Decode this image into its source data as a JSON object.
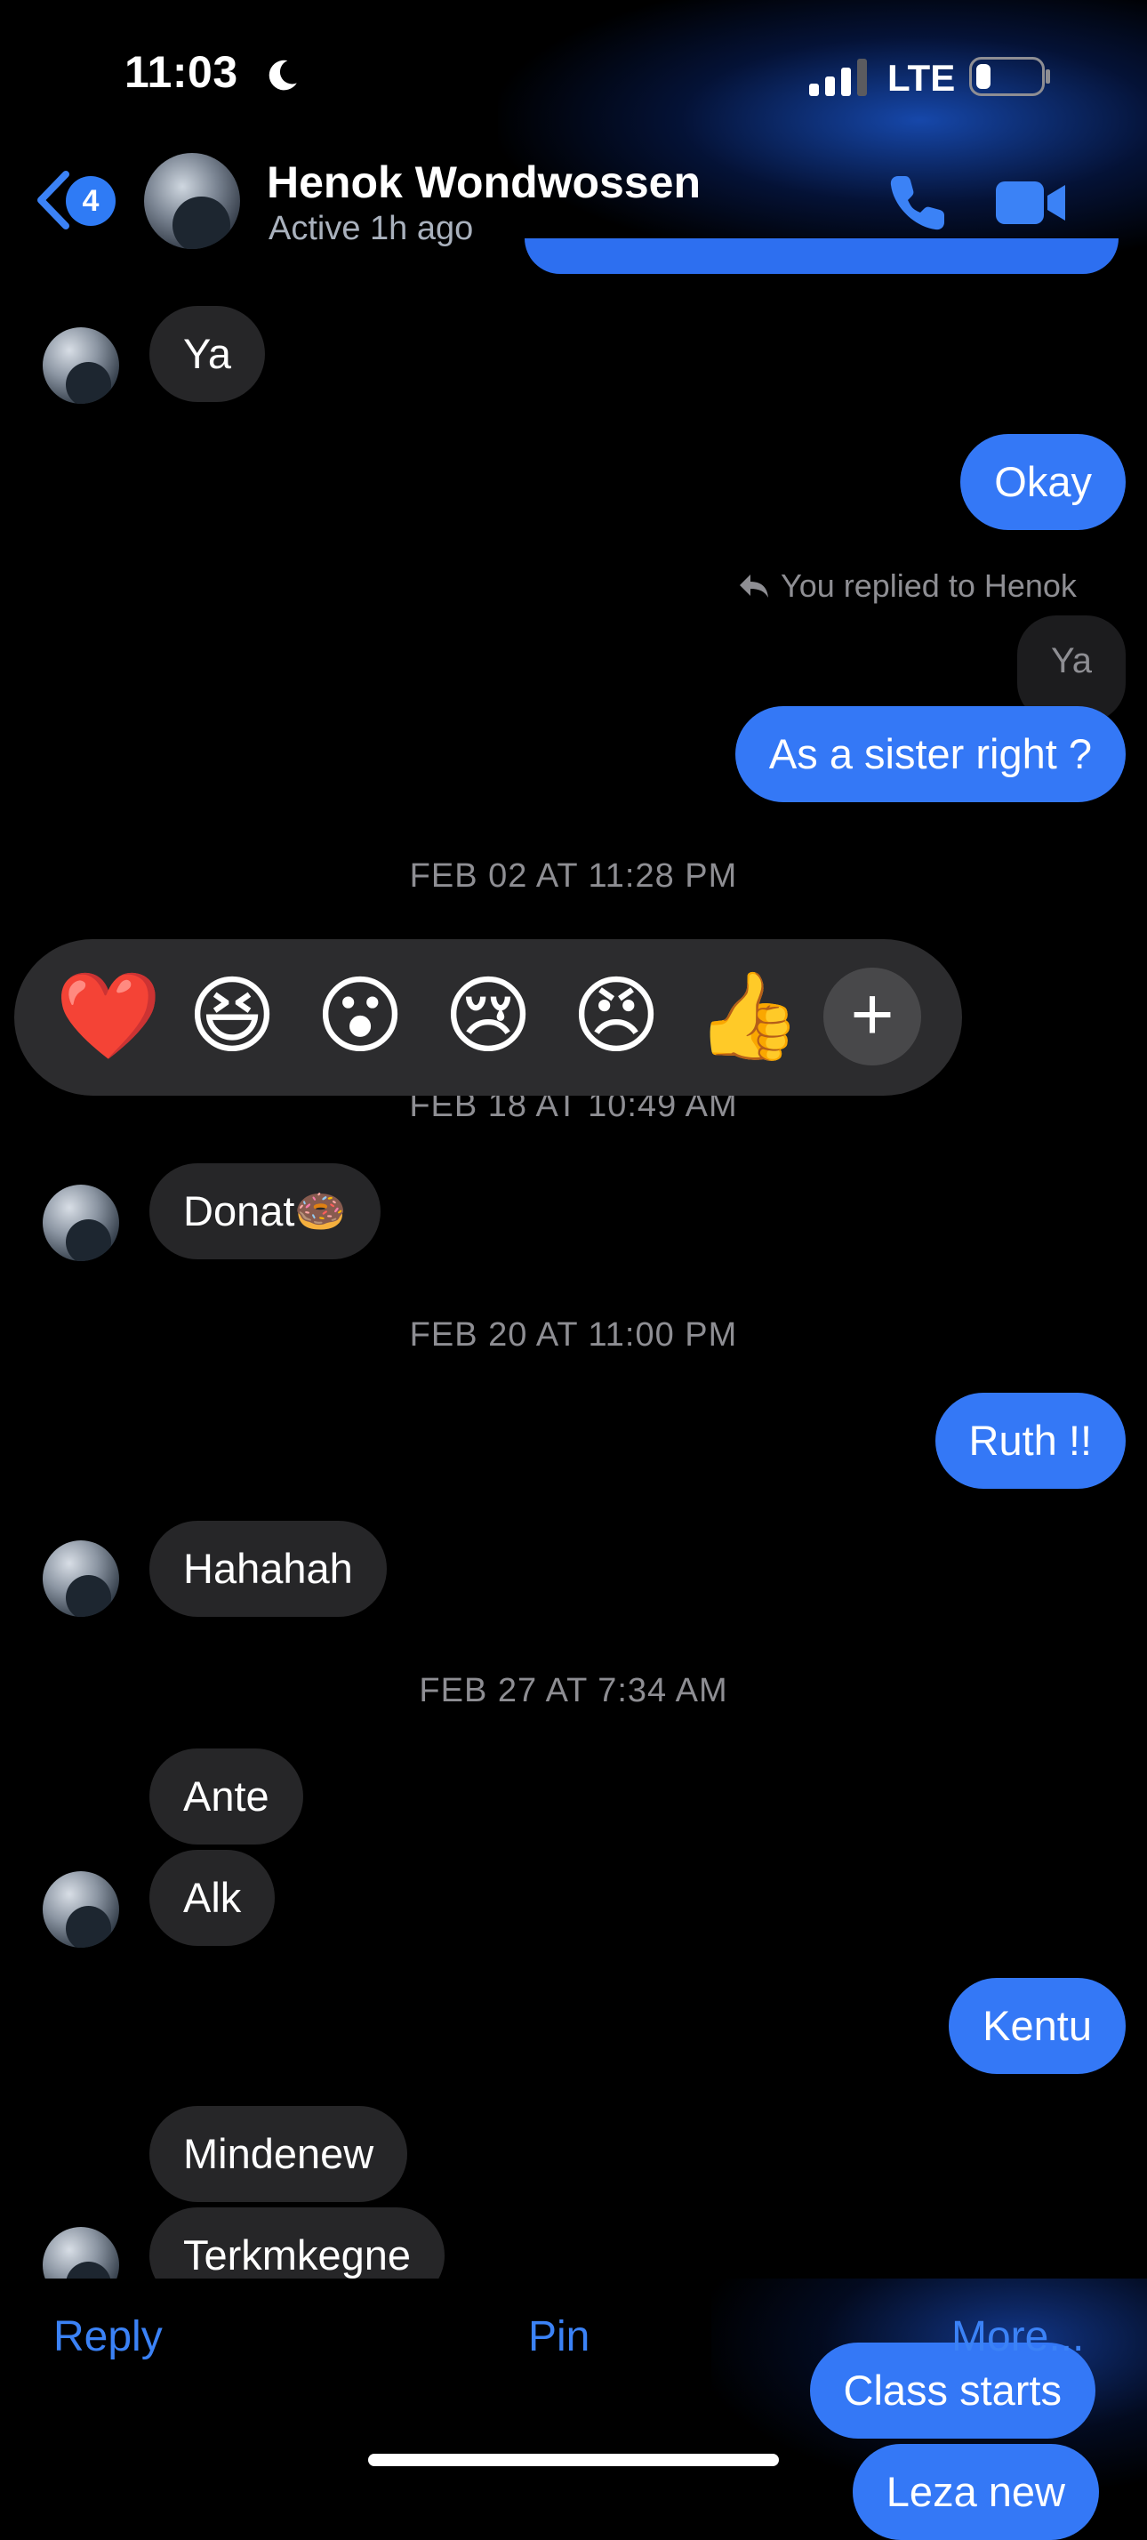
{
  "status_bar": {
    "time": "11:03",
    "network": "LTE"
  },
  "header": {
    "back_badge": "4",
    "contact_name": "Henok Wondwossen",
    "active_status": "Active 1h ago"
  },
  "messages": [
    {
      "id": "m1",
      "side": "in",
      "text": "Ya"
    },
    {
      "id": "m2",
      "side": "out",
      "text": "Okay"
    },
    {
      "id": "m3",
      "replied_label": "You replied to Henok",
      "quoted": "Ya",
      "side": "out",
      "text": "As a sister right ?"
    },
    {
      "id": "t1",
      "timestamp": "FEB 02 AT 11:28 PM"
    },
    {
      "id": "t2",
      "timestamp": "FEB 18 AT 10:49 AM"
    },
    {
      "id": "m4",
      "side": "in",
      "text": "Donat🍩"
    },
    {
      "id": "t3",
      "timestamp": "FEB 20 AT 11:00 PM"
    },
    {
      "id": "m5",
      "side": "out",
      "text": "Ruth !!"
    },
    {
      "id": "m6",
      "side": "in",
      "text": "Hahahah"
    },
    {
      "id": "t4",
      "timestamp": "FEB 27 AT 7:34 AM"
    },
    {
      "id": "m7",
      "side": "in",
      "text": "Ante"
    },
    {
      "id": "m8",
      "side": "in",
      "text": "Alk"
    },
    {
      "id": "m9",
      "side": "out",
      "text": "Kentu"
    },
    {
      "id": "m10",
      "side": "in",
      "text": "Mindenew"
    },
    {
      "id": "m11",
      "side": "in",
      "text": "Terkmkegne"
    }
  ],
  "reactions": [
    "❤️",
    "😆",
    "😮",
    "😢",
    "😠",
    "👍"
  ],
  "add_reaction": "+",
  "actions": {
    "reply": "Reply",
    "pin": "Pin",
    "more": "More..."
  },
  "behind_messages": [
    "Class starts",
    "Leza new"
  ],
  "colors": {
    "accent": "#3478f6",
    "incoming": "#262628",
    "background": "#000000"
  }
}
